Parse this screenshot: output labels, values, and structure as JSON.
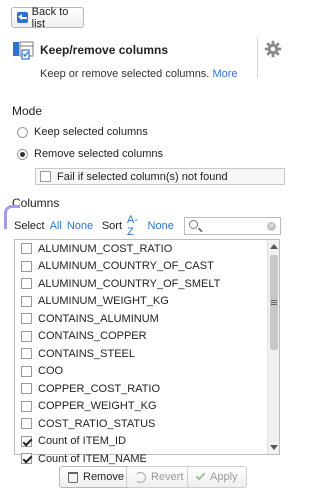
{
  "back_button": {
    "label": "Back to list"
  },
  "header": {
    "title": "Keep/remove columns",
    "description": "Keep or remove selected columns.",
    "more_link": "More"
  },
  "mode": {
    "label": "Mode",
    "options": [
      {
        "label": "Keep selected columns",
        "selected": false
      },
      {
        "label": "Remove selected columns",
        "selected": true
      }
    ],
    "fail_checkbox": {
      "label": "Fail if selected column(s) not found",
      "checked": false
    }
  },
  "columns": {
    "label": "Columns",
    "select_label": "Select",
    "select_all": "All",
    "select_none": "None",
    "sort_label": "Sort",
    "sort_az": "A-Z",
    "sort_none": "None",
    "search_placeholder": "",
    "items": [
      {
        "name": "ALUMINUM_COST_RATIO",
        "checked": false
      },
      {
        "name": "ALUMINUM_COUNTRY_OF_CAST",
        "checked": false
      },
      {
        "name": "ALUMINUM_COUNTRY_OF_SMELT",
        "checked": false
      },
      {
        "name": "ALUMINUM_WEIGHT_KG",
        "checked": false
      },
      {
        "name": "CONTAINS_ALUMINUM",
        "checked": false
      },
      {
        "name": "CONTAINS_COPPER",
        "checked": false
      },
      {
        "name": "CONTAINS_STEEL",
        "checked": false
      },
      {
        "name": "COO",
        "checked": false
      },
      {
        "name": "COPPER_COST_RATIO",
        "checked": false
      },
      {
        "name": "COPPER_WEIGHT_KG",
        "checked": false
      },
      {
        "name": "COST_RATIO_STATUS",
        "checked": false
      },
      {
        "name": "Count of ITEM_ID",
        "checked": true
      },
      {
        "name": "Count of ITEM_NAME",
        "checked": true
      }
    ]
  },
  "buttons": {
    "remove": "Remove",
    "revert": "Revert",
    "apply": "Apply"
  },
  "colors": {
    "accent": "#2f73d0",
    "highlight_mark": "#a49ce8"
  },
  "icons": [
    "back-arrow-icon",
    "recipe-icon",
    "gear-icon",
    "search-icon",
    "clear-icon",
    "trash-icon",
    "revert-icon",
    "check-icon"
  ]
}
